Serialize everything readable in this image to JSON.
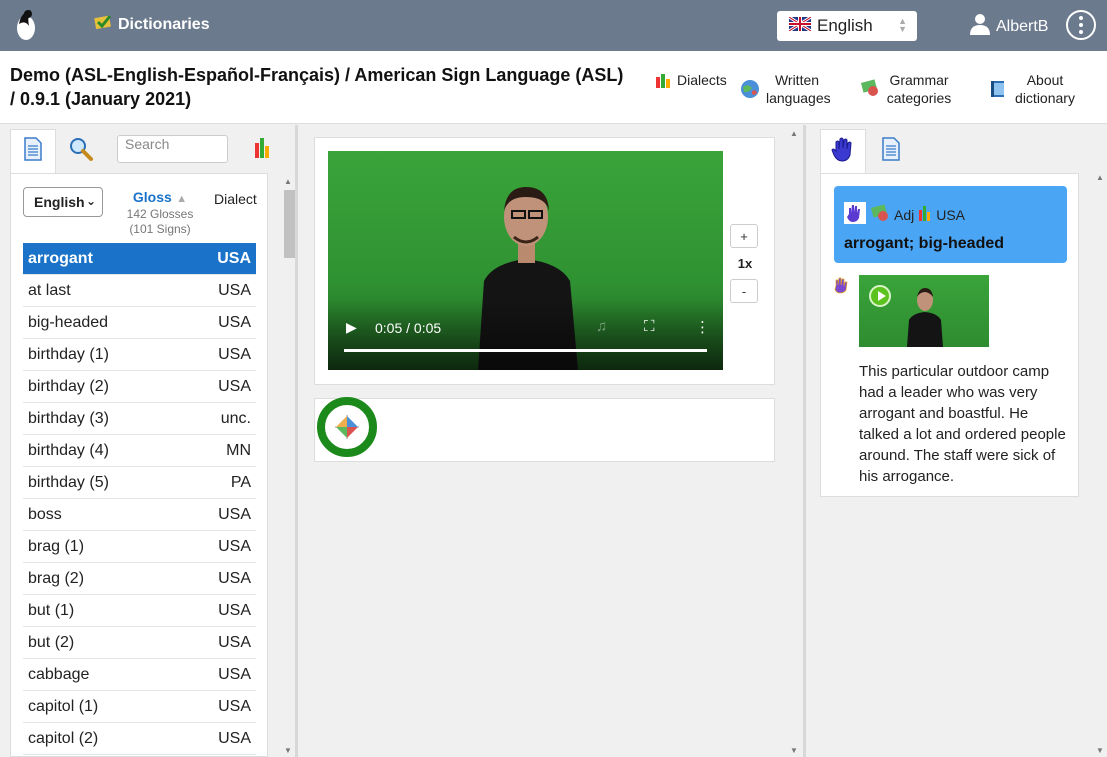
{
  "topbar": {
    "dictionaries_label": "Dictionaries",
    "language_selected": "English",
    "user_name": "AlbertB"
  },
  "header": {
    "title": "Demo (ASL-English-Español-Français) / American Sign Language (ASL) / 0.9.1 (January 2021)",
    "dialects": "Dialects",
    "written_languages": "Written languages",
    "grammar_categories": "Grammar categories",
    "about_dictionary": "About dictionary"
  },
  "left": {
    "search_placeholder": "Search",
    "language_dropdown": "English",
    "gloss_header": "Gloss",
    "gloss_count": "142 Glosses (101 Signs)",
    "dialect_header": "Dialect",
    "rows": [
      {
        "gloss": "arrogant",
        "dialect": "USA"
      },
      {
        "gloss": "at last",
        "dialect": "USA"
      },
      {
        "gloss": "big-headed",
        "dialect": "USA"
      },
      {
        "gloss": "birthday (1)",
        "dialect": "USA"
      },
      {
        "gloss": "birthday (2)",
        "dialect": "USA"
      },
      {
        "gloss": "birthday (3)",
        "dialect": "unc."
      },
      {
        "gloss": "birthday (4)",
        "dialect": "MN"
      },
      {
        "gloss": "birthday (5)",
        "dialect": "PA"
      },
      {
        "gloss": "boss",
        "dialect": "USA"
      },
      {
        "gloss": "brag (1)",
        "dialect": "USA"
      },
      {
        "gloss": "brag (2)",
        "dialect": "USA"
      },
      {
        "gloss": "but (1)",
        "dialect": "USA"
      },
      {
        "gloss": "but (2)",
        "dialect": "USA"
      },
      {
        "gloss": "cabbage",
        "dialect": "USA"
      },
      {
        "gloss": "capitol (1)",
        "dialect": "USA"
      },
      {
        "gloss": "capitol (2)",
        "dialect": "USA"
      }
    ]
  },
  "middle": {
    "video_time": "0:05 / 0:05",
    "zoom_in": "+",
    "zoom_level": "1x",
    "zoom_out": "-"
  },
  "right": {
    "grammar": "Adj",
    "dialect": "USA",
    "entry_title": "arrogant; big-headed",
    "example_text": "This particular outdoor camp had a leader who was very arrogant and boastful. He talked a lot and ordered people around. The staff were sick of his arrogance."
  },
  "colors": {
    "topbar": "#6c7a8e",
    "selected_row": "#1a73c8",
    "entry_card": "#4aa6f5",
    "video_green": "#3aa43a",
    "signwriting_ring": "#1b8a1b"
  }
}
